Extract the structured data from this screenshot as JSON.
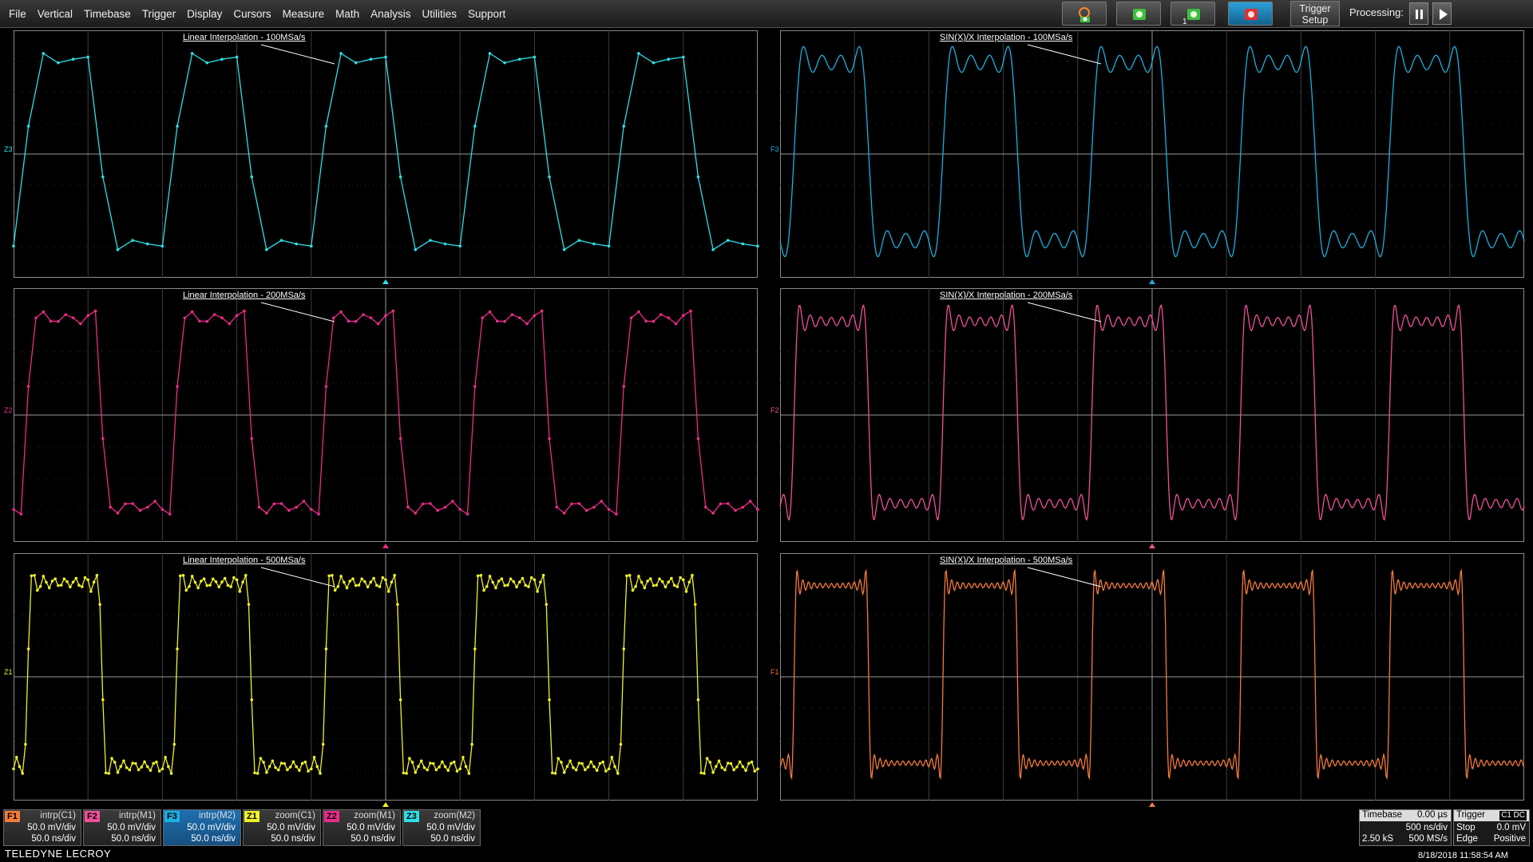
{
  "menu": {
    "items": [
      "File",
      "Vertical",
      "Timebase",
      "Trigger",
      "Display",
      "Cursors",
      "Measure",
      "Math",
      "Analysis",
      "Utilities",
      "Support"
    ]
  },
  "toolbar": {
    "trigger_setup_line1": "Trigger",
    "trigger_setup_line2": "Setup",
    "processing_label": "Processing:",
    "buttons": [
      "auto-setup-icon",
      "single-trigger-icon",
      "normal-trigger-icon",
      "stop-trigger-icon"
    ]
  },
  "grids": [
    {
      "label": "Linear Interpolation - 100MSa/s",
      "marker": "Z3",
      "color": "#2de0e8",
      "style": "linear",
      "samples_per_period": 10
    },
    {
      "label": "SIN(X)/X Interpolation - 100MSa/s",
      "marker": "F3",
      "color": "#1ab0e0",
      "style": "sinc",
      "samples_per_period": 10
    },
    {
      "label": "Linear Interpolation - 200MSa/s",
      "marker": "Z2",
      "color": "#ec2b8c",
      "style": "linear",
      "samples_per_period": 20
    },
    {
      "label": "SIN(X)/X Interpolation - 200MSa/s",
      "marker": "F2",
      "color": "#f0509a",
      "style": "sinc",
      "samples_per_period": 20
    },
    {
      "label": "Linear Interpolation - 500MSa/s",
      "marker": "Z1",
      "color": "#f0f028",
      "style": "linear",
      "samples_per_period": 50
    },
    {
      "label": "SIN(X)/X Interpolation - 500MSa/s",
      "marker": "F1",
      "color": "#f57a3a",
      "style": "sinc",
      "samples_per_period": 50
    }
  ],
  "descriptors": [
    {
      "tag": "F1",
      "tag_color": "#f57a3a",
      "source": "intrp(C1)",
      "vdiv": "50.0 mV/div",
      "tdiv": "50.0 ns/div"
    },
    {
      "tag": "F2",
      "tag_color": "#f0509a",
      "source": "intrp(M1)",
      "vdiv": "50.0 mV/div",
      "tdiv": "50.0 ns/div"
    },
    {
      "tag": "F3",
      "tag_color": "#1ab0e0",
      "source": "intrp(M2)",
      "vdiv": "50.0 mV/div",
      "tdiv": "50.0 ns/div",
      "active": true
    },
    {
      "tag": "Z1",
      "tag_color": "#f0f028",
      "source": "zoom(C1)",
      "vdiv": "50.0 mV/div",
      "tdiv": "50.0 ns/div"
    },
    {
      "tag": "Z2",
      "tag_color": "#ec2b8c",
      "source": "zoom(M1)",
      "vdiv": "50.0 mV/div",
      "tdiv": "50.0 ns/div"
    },
    {
      "tag": "Z3",
      "tag_color": "#2de0e8",
      "source": "zoom(M2)",
      "vdiv": "50.0 mV/div",
      "tdiv": "50.0 ns/div"
    }
  ],
  "timebase": {
    "title": "Timebase",
    "delay": "0.00 µs",
    "tdiv": "500 ns/div",
    "samples": "2.50 kS",
    "rate": "500 MS/s"
  },
  "trigger": {
    "title": "Trigger",
    "channel": "C1",
    "coupling": "DC",
    "mode": "Stop",
    "level": "0.0 mV",
    "type": "Edge",
    "slope": "Positive"
  },
  "brand": "TELEDYNE LECROY",
  "timestamp": "8/18/2018 11:58:54 AM"
}
